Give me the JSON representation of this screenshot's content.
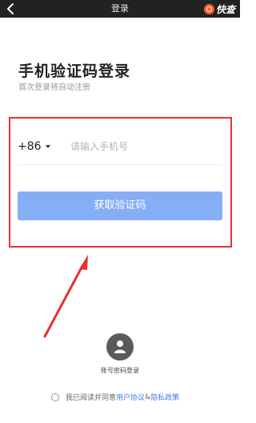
{
  "header": {
    "title": "登录",
    "brand": "快查",
    "back_icon": "chevron-left-icon"
  },
  "form": {
    "heading": "手机验证码登录",
    "subheading": "首次登录将自动注册",
    "country_code": "+86",
    "phone_placeholder": "请输入手机号",
    "phone_value": "",
    "submit_label": "获取验证码"
  },
  "alt_login": {
    "label": "账号密码登录",
    "icon": "user-icon"
  },
  "agreement": {
    "prefix": "我已阅读并同意",
    "user_agreement": "用户协议",
    "separator": "&",
    "privacy_policy": "隐私政策"
  },
  "colors": {
    "topbar": "#222222",
    "button": "#85aef7",
    "link": "#3a7cf0",
    "highlight": "#e53232",
    "brand_icon": "#ff5a2a"
  }
}
